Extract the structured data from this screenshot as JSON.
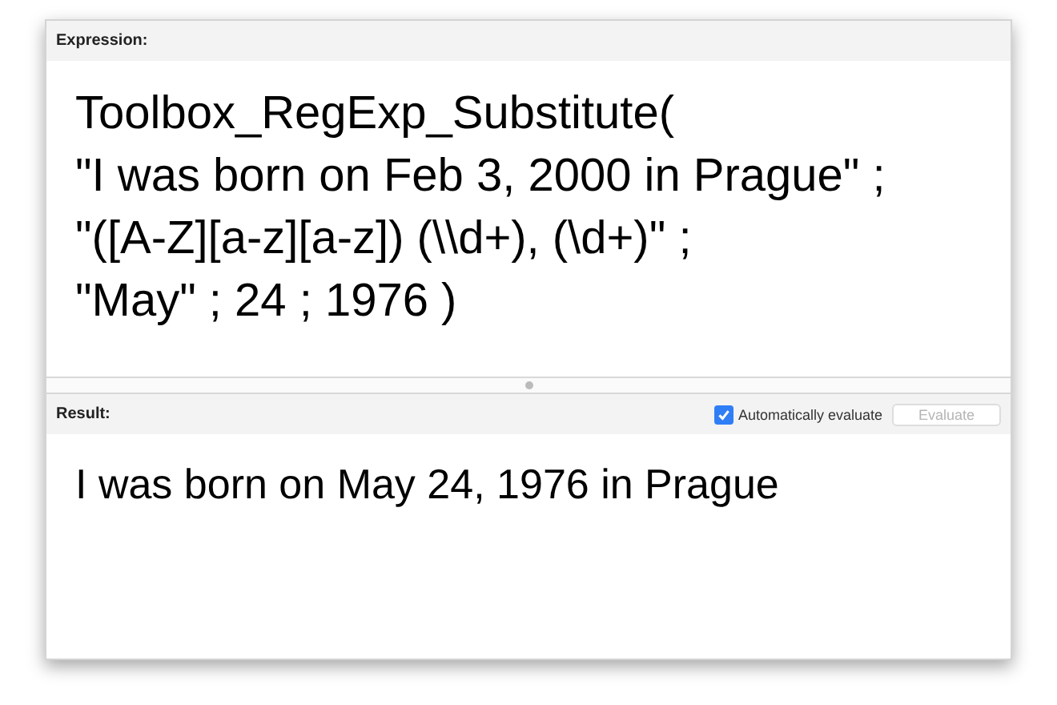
{
  "expression": {
    "label": "Expression:",
    "text": "Toolbox_RegExp_Substitute(\n\"I was born on Feb 3, 2000 in Prague\" ;\n\"([A-Z][a-z][a-z]) (\\\\d+), (\\d+)\" ;\n\"May\" ; 24 ; 1976 )"
  },
  "result": {
    "label": "Result:",
    "auto_evaluate": {
      "label": "Automatically evaluate",
      "checked": true
    },
    "evaluate_button": {
      "label": "Evaluate",
      "disabled": true
    },
    "text": "I was born on May 24, 1976 in Prague"
  }
}
